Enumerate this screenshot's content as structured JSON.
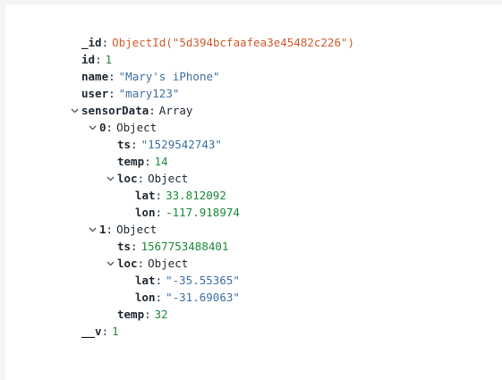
{
  "document": {
    "id_field": {
      "key": "_id",
      "value": "ObjectId(\"5d394bcfaafea3e45482c226\")"
    },
    "id": {
      "key": "id",
      "value": "1"
    },
    "name": {
      "key": "name",
      "value": "\"Mary's iPhone\""
    },
    "user": {
      "key": "user",
      "value": "\"mary123\""
    },
    "sensorData": {
      "key": "sensorData",
      "type": "Array",
      "items": [
        {
          "key": "0",
          "type": "Object",
          "ts": {
            "key": "ts",
            "value": "\"1529542743\""
          },
          "temp": {
            "key": "temp",
            "value": "14"
          },
          "loc": {
            "key": "loc",
            "type": "Object",
            "lat": {
              "key": "lat",
              "value": "33.812092"
            },
            "lon": {
              "key": "lon",
              "value": "-117.918974"
            }
          }
        },
        {
          "key": "1",
          "type": "Object",
          "ts": {
            "key": "ts",
            "value": "1567753488401"
          },
          "loc": {
            "key": "loc",
            "type": "Object",
            "lat": {
              "key": "lat",
              "value": "\"-35.55365\""
            },
            "lon": {
              "key": "lon",
              "value": "\"-31.69063\""
            }
          },
          "temp": {
            "key": "temp",
            "value": "32"
          }
        }
      ]
    },
    "v": {
      "key": "__v",
      "value": "1"
    }
  },
  "icons": {
    "expand": "chevron-down-icon"
  },
  "colors": {
    "objectid": "#d15b2e",
    "string": "#3e6fa3",
    "number": "#1d8a3a",
    "key": "#1f2933"
  }
}
